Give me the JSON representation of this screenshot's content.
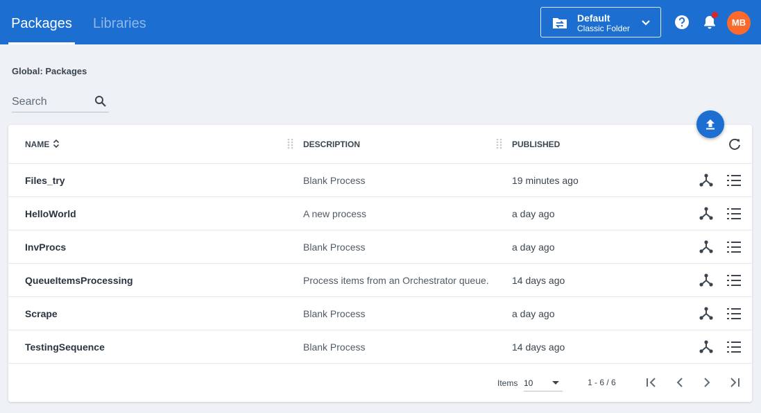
{
  "tabs": [
    {
      "label": "Packages",
      "active": true
    },
    {
      "label": "Libraries",
      "active": false
    }
  ],
  "folder": {
    "name": "Default",
    "type": "Classic Folder"
  },
  "user": {
    "initials": "MB"
  },
  "breadcrumb": "Global: Packages",
  "search": {
    "placeholder": "Search",
    "value": ""
  },
  "table": {
    "columns": [
      "NAME",
      "DESCRIPTION",
      "PUBLISHED"
    ],
    "rows": [
      {
        "name": "Files_try",
        "description": "Blank Process",
        "published": "19 minutes ago"
      },
      {
        "name": "HelloWorld",
        "description": "A new process",
        "published": "a day ago"
      },
      {
        "name": "InvProcs",
        "description": "Blank Process",
        "published": "a day ago"
      },
      {
        "name": "QueueItemsProcessing",
        "description": "Process items from an Orchestrator queue.",
        "published": "14 days ago"
      },
      {
        "name": "Scrape",
        "description": "Blank Process",
        "published": "a day ago"
      },
      {
        "name": "TestingSequence",
        "description": "Blank Process",
        "published": "14 days ago"
      }
    ]
  },
  "pagination": {
    "items_label": "Items",
    "page_size": "10",
    "range": "1 - 6 / 6"
  },
  "colors": {
    "brand": "#1c6fd1",
    "avatar": "#fa6a2c",
    "notification": "#e02424"
  },
  "icons": [
    "swap-folder-icon",
    "chevron-down-icon",
    "help-icon",
    "bell-icon",
    "search-icon",
    "upload-icon",
    "sort-icon",
    "refresh-icon",
    "deploy-icon",
    "versions-icon",
    "first-page-icon",
    "prev-page-icon",
    "next-page-icon",
    "last-page-icon"
  ]
}
